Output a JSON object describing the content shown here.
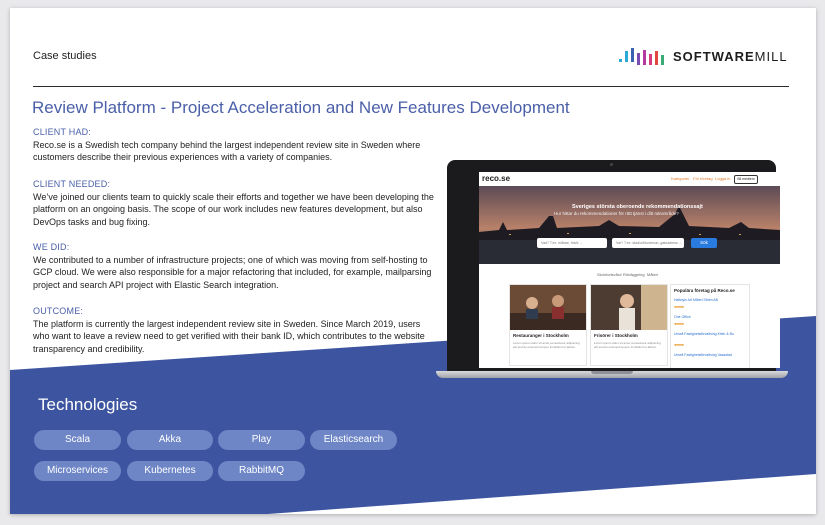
{
  "header": {
    "section_label": "Case studies",
    "logo_text_bold": "SOFTWARE",
    "logo_text_light": "MILL"
  },
  "title": "Review Platform - Project Acceleration and New Features Development",
  "sections": [
    {
      "heading": "CLIENT HAD:",
      "body": "Reco.se is a Swedish tech company behind the largest independent review site in Sweden where customers describe their previous experiences with a variety of companies."
    },
    {
      "heading": "CLIENT NEEDED:",
      "body": "We’ve joined our clients team to quickly scale their efforts and together we have been developing the platform on an ongoing basis. The scope of our work includes new features development, but also DevOps tasks and bug fixing."
    },
    {
      "heading": "WE DID:",
      "body": "We contributed to a number of infrastructure projects; one of which was moving from self-hosting to GCP cloud. We were also responsible for a major refactoring that included, for example, mailparsing project and search API project with Elastic Search integration."
    },
    {
      "heading": "OUTCOME:",
      "body": "The platform is currently the largest independent review site in Sweden. Since March 2019, users who want to leave a review need to get verified with their bank ID, which contributes to the website transparency and credibility."
    }
  ],
  "technologies": {
    "title": "Technologies",
    "items": [
      "Scala",
      "Akka",
      "Play",
      "Elasticsearch",
      "Microservices",
      "Kubernetes",
      "RabbitMQ"
    ]
  },
  "colors": {
    "accent": "#4a5fa8",
    "band": "#3d55a0",
    "pill": "#6e86c6"
  },
  "mock_site": {
    "logo": "reco.se",
    "nav": [
      "Kategorier",
      "För företag",
      "Logga in"
    ],
    "nav_button": "Bli medlem",
    "hero_heading": "Sveriges största oberoende rekommendationssajt",
    "hero_sub": "Hur hittar du rekommendationer för rätt tjänst i ditt närområde?",
    "search_placeholder_1": "Vad? T.ex. målare, frisör ...",
    "search_placeholder_2": "Var? T.ex. stad/ort/kommun, gatuadress ...",
    "search_button": "Sök",
    "tabs": [
      "Skönhetsvård",
      "Rörläggning",
      "Måleri"
    ],
    "cards": [
      {
        "title": "Restauranger i Stockholm",
        "text": "Lorem ipsum dolor sit amet consectetur adipiscing elit sed do eiusmod tempor incididunt ut labore."
      },
      {
        "title": "Frisörer i Stockholm",
        "text": "Lorem ipsum dolor sit amet consectetur adipiscing elit sed do eiusmod tempor incididunt ut labore."
      }
    ],
    "sidebar_title": "Populära företag på Reco.se",
    "sidebar_links": [
      "Hallwyls Art Måleri Sthlm AB",
      "One Office",
      "Umeå Fastighetsförvaltning Klein & Bo",
      "Umeå Fastighetsförvaltning Vasastad"
    ]
  }
}
